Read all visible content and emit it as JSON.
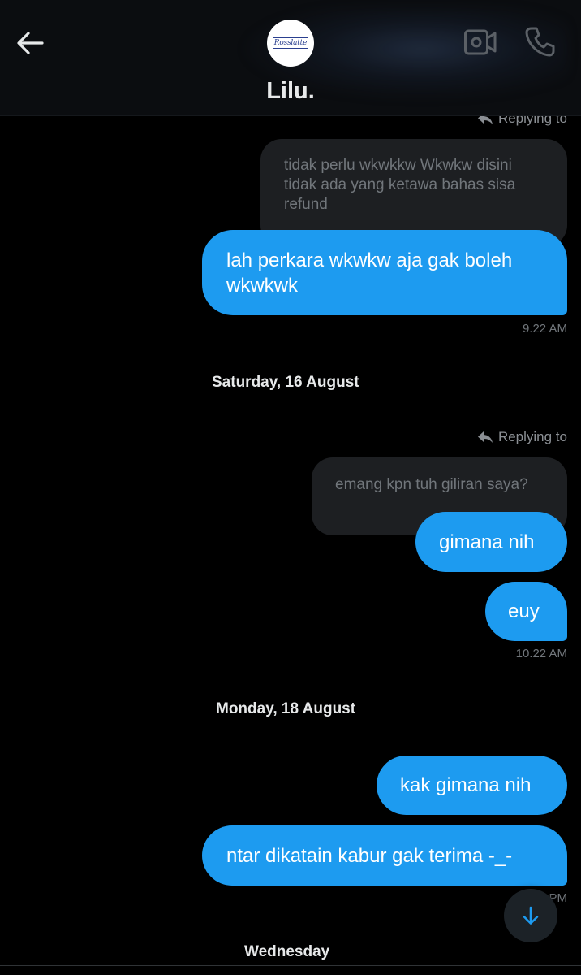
{
  "header": {
    "title": "Lilu.",
    "avatar_text": "Rosslatte",
    "icons": {
      "back": "back-arrow-icon",
      "video": "video-call-icon",
      "call": "phone-call-icon"
    }
  },
  "messages": {
    "reply1": {
      "label": "Replying to",
      "quote": "tidak perlu wkwkkw Wkwkw disini tidak ada yang ketawa bahas sisa refund"
    },
    "m1": {
      "text": "lah perkara wkwkw aja gak boleh wkwkwk",
      "time": "9.22 AM"
    },
    "date1": "Saturday, 16 August",
    "reply2": {
      "label": "Replying to",
      "quote": "emang kpn tuh giliran saya?"
    },
    "m2": {
      "text": "gimana nih"
    },
    "m3": {
      "text": "euy",
      "time": "10.22 AM"
    },
    "date2": "Monday, 18 August",
    "m4": {
      "text": "kak gimana nih"
    },
    "m5": {
      "text": "ntar dikatain kabur gak terima -_-",
      "time": "PM"
    },
    "date3": "Wednesday"
  },
  "colors": {
    "accent": "#1d9bf0",
    "background": "#000000",
    "quote_bg": "#1d1f22",
    "muted_text": "#71767b"
  }
}
